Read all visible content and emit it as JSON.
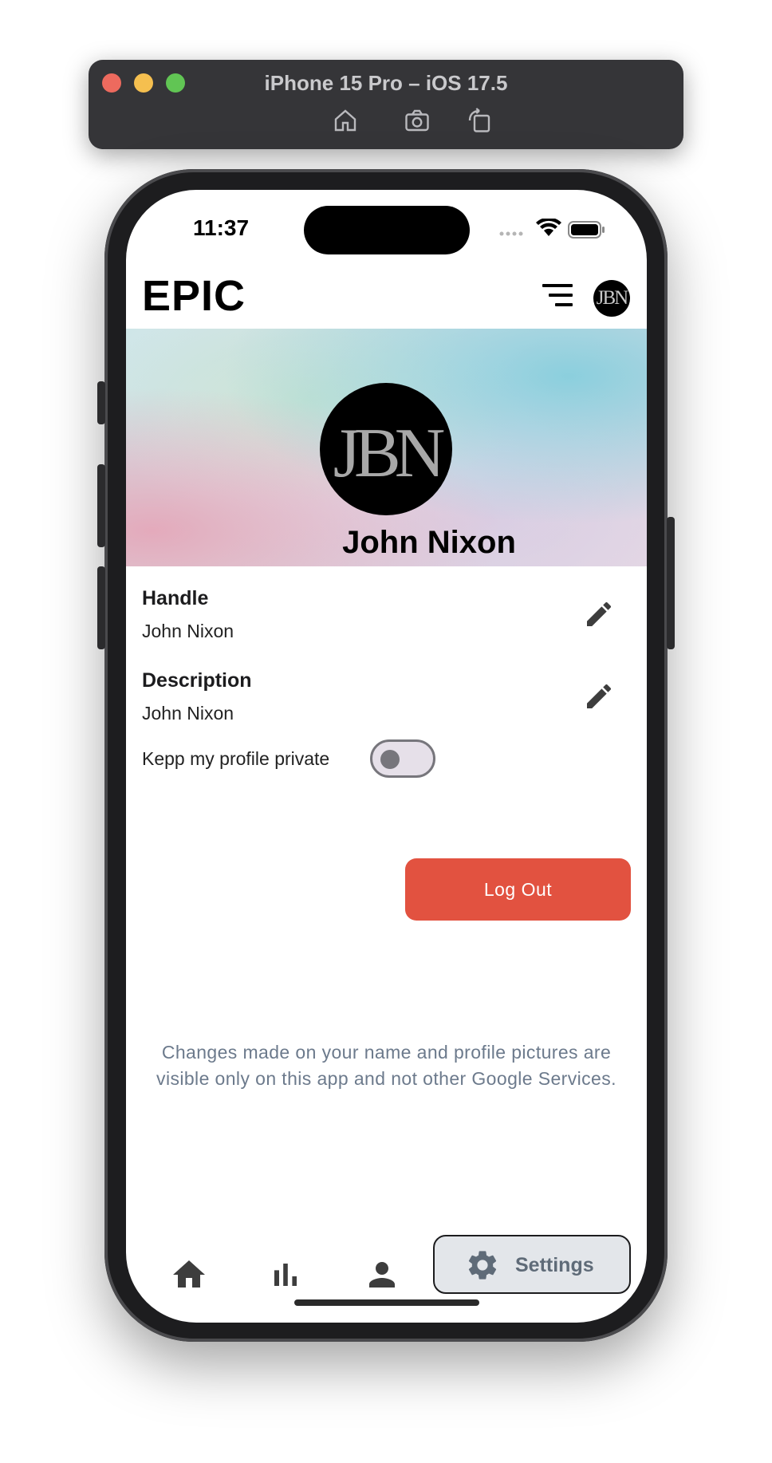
{
  "simulator": {
    "title": "iPhone 15 Pro – iOS 17.5",
    "tools": [
      "home-icon",
      "screenshot-icon",
      "rotate-icon"
    ]
  },
  "status_bar": {
    "time": "11:37",
    "icons": [
      "cellular-icon",
      "wifi-icon",
      "battery-icon"
    ]
  },
  "app_bar": {
    "title": "EPIC",
    "avatar_initials": "JBN",
    "menu_icon": "menu-icon"
  },
  "profile": {
    "avatar_initials": "JBN",
    "name": "John Nixon"
  },
  "fields": {
    "handle": {
      "label": "Handle",
      "value": "John Nixon"
    },
    "description": {
      "label": "Description",
      "value": "John Nixon"
    }
  },
  "privacy": {
    "label": "Kepp my profile private",
    "enabled": false
  },
  "actions": {
    "logout_label": "Log Out"
  },
  "notice": "Changes made on your name and profile pictures are visible only on this app and not other Google Services.",
  "bottom_nav": {
    "items": [
      {
        "icon": "home-icon",
        "active": false
      },
      {
        "icon": "bar-chart-icon",
        "active": false
      },
      {
        "icon": "person-icon",
        "active": false
      },
      {
        "icon": "gear-icon",
        "label": "Settings",
        "active": true
      }
    ]
  },
  "colors": {
    "accent_logout": "#e25240",
    "notice_text": "#6c7a8c",
    "nav_icon": "#3d3d3d",
    "settings_icon": "#5f6b78"
  }
}
